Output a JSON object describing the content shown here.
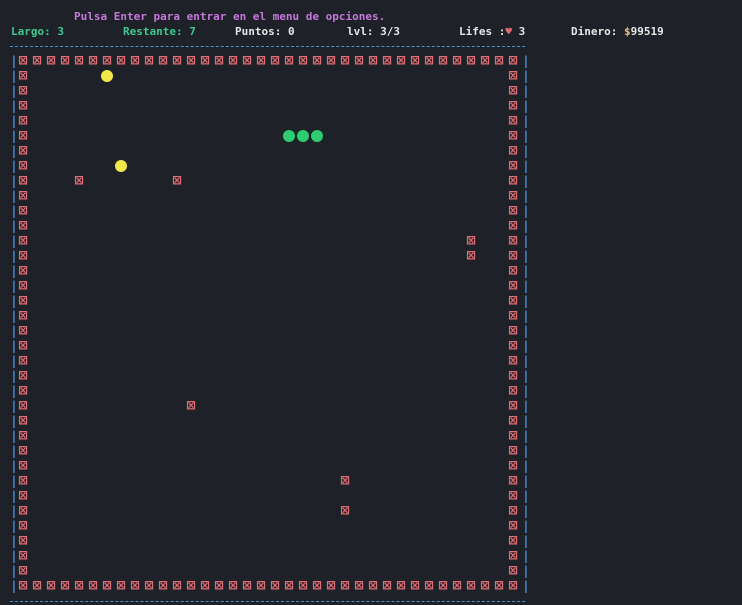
{
  "hint": "Pulsa Enter para entrar en el menu de opciones.",
  "stats": {
    "largo_label": "Largo:",
    "largo_value": "3",
    "restante_label": "Restante:",
    "restante_value": "7",
    "puntos_label": "Puntos:",
    "puntos_value": "0",
    "lvl_label": "lvl:",
    "lvl_value": "3/3",
    "lifes_label": "Lifes :",
    "lifes_heart": "♥",
    "lifes_value": "3",
    "dinero_label": "Dinero:",
    "dinero_currency": "$",
    "dinero_value": "99519"
  },
  "board": {
    "wall_glyph": "⊠",
    "edge_glyph": "|",
    "cols": 36,
    "rows": 36,
    "obstacles": [
      [
        4,
        8
      ],
      [
        11,
        8
      ],
      [
        32,
        12
      ],
      [
        32,
        13
      ],
      [
        12,
        23
      ],
      [
        23,
        28
      ],
      [
        23,
        30
      ]
    ],
    "snake": [
      [
        19,
        5
      ],
      [
        20,
        5
      ],
      [
        21,
        5
      ]
    ],
    "food": [
      [
        6,
        1
      ],
      [
        7,
        7
      ]
    ]
  },
  "colors": {
    "wall": "#e06c75",
    "border": "#4a90d9",
    "snake": "#2ecc71",
    "food": "#f1e84a",
    "background": "#1e2127"
  }
}
